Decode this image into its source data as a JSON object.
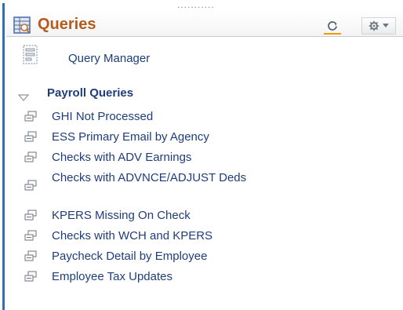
{
  "header": {
    "title": "Queries",
    "grip": "...........",
    "icons": {
      "title": "query-table-icon",
      "refresh": "refresh-icon",
      "settings": "gear-icon",
      "menu": "chevron-down-icon"
    }
  },
  "query_manager": {
    "label": "Query Manager",
    "icon": "query-manager-icon"
  },
  "section": {
    "label": "Payroll Queries",
    "expanded": true,
    "items": [
      {
        "label": "GHI Not Processed"
      },
      {
        "label": "ESS Primary Email by Agency"
      },
      {
        "label": "Checks with ADV Earnings"
      },
      {
        "label": "Checks with ADVNCE/ADJUST Deds"
      },
      {
        "label": "KPERS Missing On Check"
      },
      {
        "label": "Checks with WCH and KPERS"
      },
      {
        "label": "Paycheck Detail by Employee"
      },
      {
        "label": "Employee Tax Updates"
      }
    ]
  },
  "colors": {
    "title": "#b55b1d",
    "link": "#1f3d7a",
    "accent_rule": "#2f6fb6",
    "refresh_underline": "#f19a00"
  }
}
